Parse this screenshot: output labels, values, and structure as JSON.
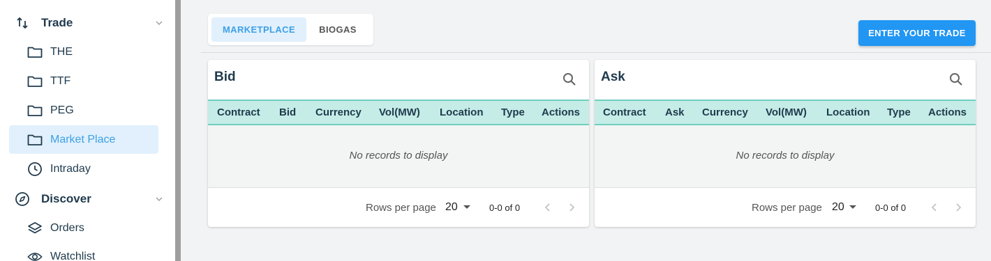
{
  "sidebar": {
    "sections": [
      {
        "label": "Trade",
        "icon": "swap-vertical-icon"
      },
      {
        "label": "Discover",
        "icon": "compass-icon"
      }
    ],
    "trade_items": [
      {
        "label": "THE",
        "icon": "folder-icon"
      },
      {
        "label": "TTF",
        "icon": "folder-icon"
      },
      {
        "label": "PEG",
        "icon": "folder-icon"
      },
      {
        "label": "Market Place",
        "icon": "folder-icon",
        "active": true
      },
      {
        "label": "Intraday",
        "icon": "clock-icon"
      }
    ],
    "discover_items": [
      {
        "label": "Orders",
        "icon": "layers-icon"
      },
      {
        "label": "Watchlist",
        "icon": "eye-icon"
      }
    ]
  },
  "tabs": [
    {
      "label": "MARKETPLACE",
      "active": true
    },
    {
      "label": "BIOGAS",
      "active": false
    }
  ],
  "enter_trade_label": "ENTER YOUR TRADE",
  "bid": {
    "title": "Bid",
    "columns": [
      "Contract",
      "Bid",
      "Currency",
      "Vol(MW)",
      "Location",
      "Type",
      "Actions"
    ],
    "empty_text": "No records to display",
    "rows_per_page_label": "Rows per page",
    "rows_per_page": "20",
    "range": "0-0 of 0"
  },
  "ask": {
    "title": "Ask",
    "columns": [
      "Contract",
      "Ask",
      "Currency",
      "Vol(MW)",
      "Location",
      "Type",
      "Actions"
    ],
    "empty_text": "No records to display",
    "rows_per_page_label": "Rows per page",
    "rows_per_page": "20",
    "range": "0-0 of 0"
  },
  "colors": {
    "accent": "#2196f3",
    "active_bg": "#e1f0fc",
    "active_text": "#3da0e6",
    "table_header_bg": "#c5ece6",
    "table_header_border": "#6fcfbf",
    "text_dark": "#1f3a4d"
  }
}
